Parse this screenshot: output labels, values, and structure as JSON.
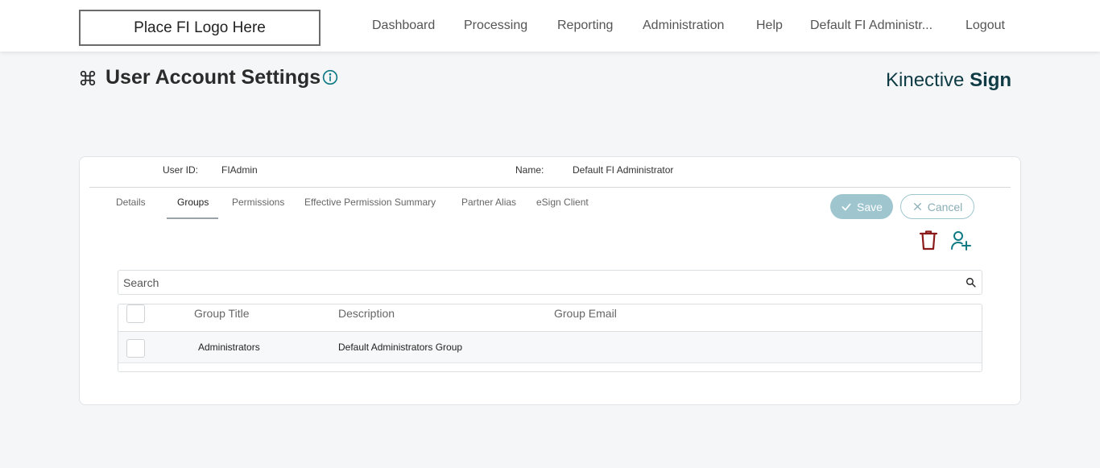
{
  "header": {
    "logo_text": "Place FI Logo Here",
    "nav": {
      "dashboard": "Dashboard",
      "processing": "Processing",
      "reporting": "Reporting",
      "administration": "Administration",
      "help": "Help",
      "user": "Default FI Administr...",
      "logout": "Logout"
    }
  },
  "page": {
    "title": "User Account Settings",
    "brand_light": "Kinective ",
    "brand_bold": "Sign"
  },
  "user": {
    "id_label": "User ID:",
    "id_value": "FIAdmin",
    "name_label": "Name:",
    "name_value": "Default FI Administrator"
  },
  "tabs": [
    "Details",
    "Groups",
    "Permissions",
    "Effective Permission Summary",
    "Partner Alias",
    "eSign Client"
  ],
  "active_tab": "Groups",
  "actions": {
    "save_label": "Save",
    "cancel_label": "Cancel"
  },
  "search": {
    "placeholder": "Search",
    "value": ""
  },
  "table": {
    "columns": [
      "Group Title",
      "Description",
      "Group Email"
    ],
    "rows": [
      {
        "title": "Administrators",
        "description": "Default Administrators Group",
        "email": "",
        "checked": false
      }
    ]
  },
  "colors": {
    "accent": "#0f7a85",
    "save_bg": "#9fc6cf",
    "delete": "#8b1a1a",
    "brand": "#0e3b44"
  },
  "icons": [
    "command-icon",
    "info-icon",
    "check-icon",
    "close-icon",
    "trash-icon",
    "add-user-icon",
    "search-icon"
  ]
}
